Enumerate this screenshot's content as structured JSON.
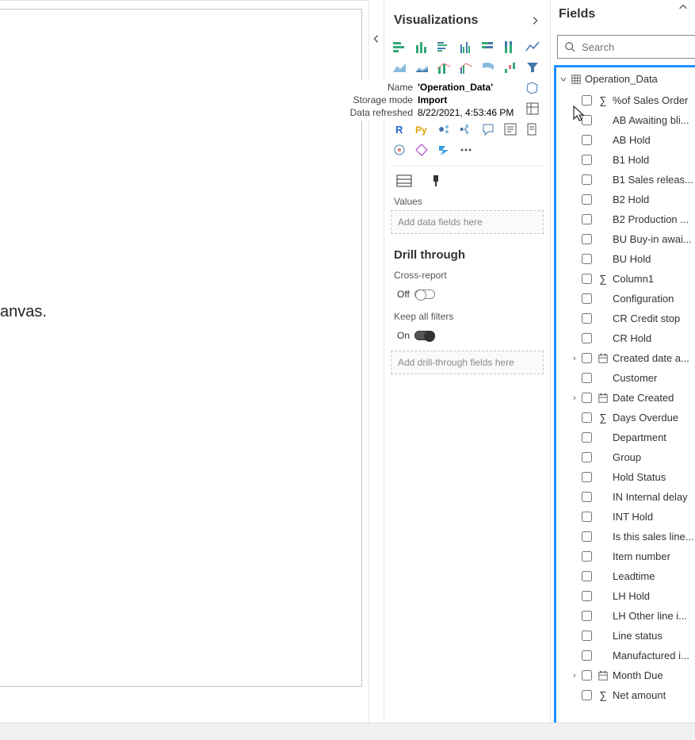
{
  "top": {
    "collapse_icon": "chevron-up"
  },
  "canvas": {
    "text": "anvas."
  },
  "viz": {
    "title": "Visualizations",
    "values_label": "Values",
    "values_placeholder": "Add data fields here",
    "drill": {
      "header": "Drill through",
      "cross_report": "Cross-report",
      "cross_state": "Off",
      "keep_filters": "Keep all filters",
      "keep_state": "On",
      "drill_placeholder": "Add drill-through fields here"
    }
  },
  "tooltip": {
    "name_label": "Name",
    "name_value": "'Operation_Data'",
    "storage_label": "Storage mode",
    "storage_value": "Import",
    "refreshed_label": "Data refreshed",
    "refreshed_value": "8/22/2021, 4:53:46 PM"
  },
  "fields": {
    "title": "Fields",
    "search_placeholder": "Search",
    "table_name": "Operation_Data",
    "items": [
      {
        "label": "%of Sales Order",
        "sigma": true,
        "hier": false
      },
      {
        "label": "AB Awaiting bli...",
        "sigma": false,
        "hier": false
      },
      {
        "label": "AB Hold",
        "sigma": false,
        "hier": false
      },
      {
        "label": "B1 Hold",
        "sigma": false,
        "hier": false
      },
      {
        "label": "B1 Sales releas...",
        "sigma": false,
        "hier": false
      },
      {
        "label": "B2 Hold",
        "sigma": false,
        "hier": false
      },
      {
        "label": "B2 Production ...",
        "sigma": false,
        "hier": false
      },
      {
        "label": "BU Buy-in awai...",
        "sigma": false,
        "hier": false
      },
      {
        "label": "BU Hold",
        "sigma": false,
        "hier": false
      },
      {
        "label": "Column1",
        "sigma": true,
        "hier": false
      },
      {
        "label": "Configuration",
        "sigma": false,
        "hier": false
      },
      {
        "label": "CR Credit stop",
        "sigma": false,
        "hier": false
      },
      {
        "label": "CR Hold",
        "sigma": false,
        "hier": false
      },
      {
        "label": "Created date a...",
        "sigma": false,
        "hier": true
      },
      {
        "label": "Customer",
        "sigma": false,
        "hier": false
      },
      {
        "label": "Date Created",
        "sigma": false,
        "hier": true
      },
      {
        "label": "Days Overdue",
        "sigma": true,
        "hier": false
      },
      {
        "label": "Department",
        "sigma": false,
        "hier": false
      },
      {
        "label": "Group",
        "sigma": false,
        "hier": false
      },
      {
        "label": "Hold Status",
        "sigma": false,
        "hier": false
      },
      {
        "label": "IN Internal delay",
        "sigma": false,
        "hier": false
      },
      {
        "label": "INT Hold",
        "sigma": false,
        "hier": false
      },
      {
        "label": "Is this sales line...",
        "sigma": false,
        "hier": false
      },
      {
        "label": "Item number",
        "sigma": false,
        "hier": false
      },
      {
        "label": "Leadtime",
        "sigma": false,
        "hier": false
      },
      {
        "label": "LH Hold",
        "sigma": false,
        "hier": false
      },
      {
        "label": "LH Other line i...",
        "sigma": false,
        "hier": false
      },
      {
        "label": "Line status",
        "sigma": false,
        "hier": false
      },
      {
        "label": "Manufactured i...",
        "sigma": false,
        "hier": false
      },
      {
        "label": "Month Due",
        "sigma": false,
        "hier": true
      },
      {
        "label": "Net amount",
        "sigma": true,
        "hier": false
      }
    ]
  }
}
